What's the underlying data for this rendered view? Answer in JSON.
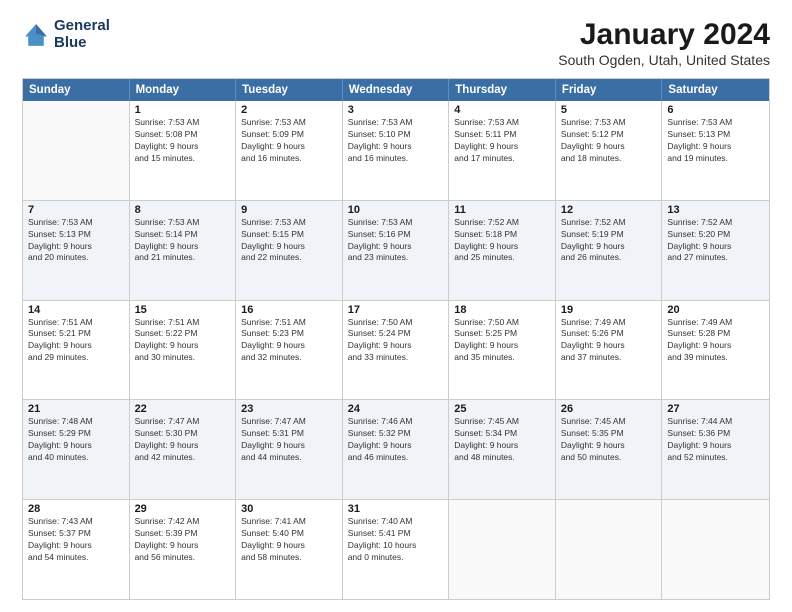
{
  "logo": {
    "line1": "General",
    "line2": "Blue"
  },
  "title": "January 2024",
  "subtitle": "South Ogden, Utah, United States",
  "dayNames": [
    "Sunday",
    "Monday",
    "Tuesday",
    "Wednesday",
    "Thursday",
    "Friday",
    "Saturday"
  ],
  "weeks": [
    {
      "alt": false,
      "days": [
        {
          "num": "",
          "info": ""
        },
        {
          "num": "1",
          "info": "Sunrise: 7:53 AM\nSunset: 5:08 PM\nDaylight: 9 hours\nand 15 minutes."
        },
        {
          "num": "2",
          "info": "Sunrise: 7:53 AM\nSunset: 5:09 PM\nDaylight: 9 hours\nand 16 minutes."
        },
        {
          "num": "3",
          "info": "Sunrise: 7:53 AM\nSunset: 5:10 PM\nDaylight: 9 hours\nand 16 minutes."
        },
        {
          "num": "4",
          "info": "Sunrise: 7:53 AM\nSunset: 5:11 PM\nDaylight: 9 hours\nand 17 minutes."
        },
        {
          "num": "5",
          "info": "Sunrise: 7:53 AM\nSunset: 5:12 PM\nDaylight: 9 hours\nand 18 minutes."
        },
        {
          "num": "6",
          "info": "Sunrise: 7:53 AM\nSunset: 5:13 PM\nDaylight: 9 hours\nand 19 minutes."
        }
      ]
    },
    {
      "alt": true,
      "days": [
        {
          "num": "7",
          "info": "Sunrise: 7:53 AM\nSunset: 5:13 PM\nDaylight: 9 hours\nand 20 minutes."
        },
        {
          "num": "8",
          "info": "Sunrise: 7:53 AM\nSunset: 5:14 PM\nDaylight: 9 hours\nand 21 minutes."
        },
        {
          "num": "9",
          "info": "Sunrise: 7:53 AM\nSunset: 5:15 PM\nDaylight: 9 hours\nand 22 minutes."
        },
        {
          "num": "10",
          "info": "Sunrise: 7:53 AM\nSunset: 5:16 PM\nDaylight: 9 hours\nand 23 minutes."
        },
        {
          "num": "11",
          "info": "Sunrise: 7:52 AM\nSunset: 5:18 PM\nDaylight: 9 hours\nand 25 minutes."
        },
        {
          "num": "12",
          "info": "Sunrise: 7:52 AM\nSunset: 5:19 PM\nDaylight: 9 hours\nand 26 minutes."
        },
        {
          "num": "13",
          "info": "Sunrise: 7:52 AM\nSunset: 5:20 PM\nDaylight: 9 hours\nand 27 minutes."
        }
      ]
    },
    {
      "alt": false,
      "days": [
        {
          "num": "14",
          "info": "Sunrise: 7:51 AM\nSunset: 5:21 PM\nDaylight: 9 hours\nand 29 minutes."
        },
        {
          "num": "15",
          "info": "Sunrise: 7:51 AM\nSunset: 5:22 PM\nDaylight: 9 hours\nand 30 minutes."
        },
        {
          "num": "16",
          "info": "Sunrise: 7:51 AM\nSunset: 5:23 PM\nDaylight: 9 hours\nand 32 minutes."
        },
        {
          "num": "17",
          "info": "Sunrise: 7:50 AM\nSunset: 5:24 PM\nDaylight: 9 hours\nand 33 minutes."
        },
        {
          "num": "18",
          "info": "Sunrise: 7:50 AM\nSunset: 5:25 PM\nDaylight: 9 hours\nand 35 minutes."
        },
        {
          "num": "19",
          "info": "Sunrise: 7:49 AM\nSunset: 5:26 PM\nDaylight: 9 hours\nand 37 minutes."
        },
        {
          "num": "20",
          "info": "Sunrise: 7:49 AM\nSunset: 5:28 PM\nDaylight: 9 hours\nand 39 minutes."
        }
      ]
    },
    {
      "alt": true,
      "days": [
        {
          "num": "21",
          "info": "Sunrise: 7:48 AM\nSunset: 5:29 PM\nDaylight: 9 hours\nand 40 minutes."
        },
        {
          "num": "22",
          "info": "Sunrise: 7:47 AM\nSunset: 5:30 PM\nDaylight: 9 hours\nand 42 minutes."
        },
        {
          "num": "23",
          "info": "Sunrise: 7:47 AM\nSunset: 5:31 PM\nDaylight: 9 hours\nand 44 minutes."
        },
        {
          "num": "24",
          "info": "Sunrise: 7:46 AM\nSunset: 5:32 PM\nDaylight: 9 hours\nand 46 minutes."
        },
        {
          "num": "25",
          "info": "Sunrise: 7:45 AM\nSunset: 5:34 PM\nDaylight: 9 hours\nand 48 minutes."
        },
        {
          "num": "26",
          "info": "Sunrise: 7:45 AM\nSunset: 5:35 PM\nDaylight: 9 hours\nand 50 minutes."
        },
        {
          "num": "27",
          "info": "Sunrise: 7:44 AM\nSunset: 5:36 PM\nDaylight: 9 hours\nand 52 minutes."
        }
      ]
    },
    {
      "alt": false,
      "days": [
        {
          "num": "28",
          "info": "Sunrise: 7:43 AM\nSunset: 5:37 PM\nDaylight: 9 hours\nand 54 minutes."
        },
        {
          "num": "29",
          "info": "Sunrise: 7:42 AM\nSunset: 5:39 PM\nDaylight: 9 hours\nand 56 minutes."
        },
        {
          "num": "30",
          "info": "Sunrise: 7:41 AM\nSunset: 5:40 PM\nDaylight: 9 hours\nand 58 minutes."
        },
        {
          "num": "31",
          "info": "Sunrise: 7:40 AM\nSunset: 5:41 PM\nDaylight: 10 hours\nand 0 minutes."
        },
        {
          "num": "",
          "info": ""
        },
        {
          "num": "",
          "info": ""
        },
        {
          "num": "",
          "info": ""
        }
      ]
    }
  ]
}
